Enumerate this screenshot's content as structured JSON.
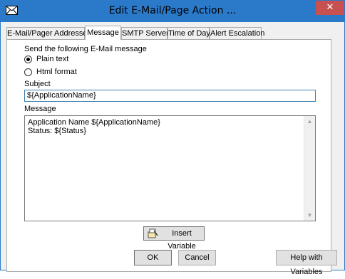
{
  "window": {
    "title": "Edit E-Mail/Page Action ...",
    "close_glyph": "✕"
  },
  "tabs": [
    {
      "label": "E-Mail/Pager Addresses"
    },
    {
      "label": "Message"
    },
    {
      "label": "SMTP Server"
    },
    {
      "label": "Time of Day"
    },
    {
      "label": "Alert Escalation"
    }
  ],
  "message_tab": {
    "format_group_label": "Send the following E-Mail message",
    "plain_text_label": "Plain text",
    "html_format_label": "Html format",
    "selected_format": "Plain text",
    "subject_label": "Subject",
    "subject_value": "${ApplicationName}",
    "message_label": "Message",
    "message_line1": "Application Name ${ApplicationName}",
    "message_line2": "Status: ${Status}",
    "insert_variable_label": "Insert Variable"
  },
  "buttons": {
    "ok": "OK",
    "cancel": "Cancel",
    "help": "Help with Variables"
  },
  "icons": [
    "envelope-icon",
    "close-icon",
    "insert-variable-icon",
    "scroll-up-icon",
    "scroll-down-icon"
  ]
}
